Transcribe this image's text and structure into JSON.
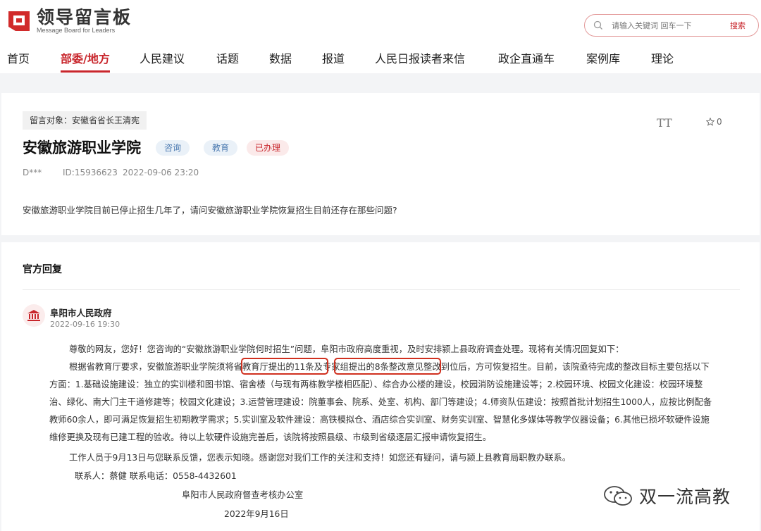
{
  "header": {
    "logo_title": "领导留言板",
    "logo_sub": "Message Board for Leaders",
    "search_placeholder": "请输入关键词 回车一下",
    "search_button": "搜索"
  },
  "nav": {
    "items": [
      "首页",
      "部委/地方",
      "人民建议",
      "话题",
      "数据",
      "报道",
      "人民日报读者来信",
      "政企直通车",
      "案例库",
      "理论"
    ],
    "active_index": 1
  },
  "message": {
    "target": "留言对象：安徽省省长王清宪",
    "title": "安徽旅游职业学院",
    "tags": [
      "咨询",
      "教育",
      "已办理"
    ],
    "author": "D***",
    "id": "ID:15936623",
    "time": "2022-09-06 23:20",
    "star_count": "0",
    "font_toggle": "TT",
    "question": "安徽旅游职业学院目前已停止招生几年了，请问安徽旅游职业学院恢复招生目前还存在那些问题?"
  },
  "reply": {
    "heading": "官方回复",
    "org": "阜阳市人民政府",
    "time": "2022-09-16 19:30",
    "lines": [
      "尊敬的网友，您好！您咨询的“安徽旅游职业学院何时招生”问题，阜阳市政府高度重视，及时安排颍上县政府调查处理。现将有关情况回复如下：",
      "根据省教育厅要求，安徽旅游职业学院须将省教育厅提出的11条及专家组提出的8条整改意见整改到位后，方可恢复招生。目前，该院亟待完成的整改目标主要包括以下",
      "方面：1.基础设施建设：独立的实训楼和图书馆、宿舍楼（与现有两栋教学楼相匹配）、综合办公楼的建设，校园消防设施建设等；2.校园环境、校园文化建设：校园环境整",
      "治、绿化、南大门主干道修建等；校园文化建设；3.运营管理建设：院董事会、院系、处室、机构、部门等建设；4.师资队伍建设：按照首批计划招生1000人，应按比例配备",
      "教师60余人，即可满足恢复招生初期教学需求；5.实训室及软件建设：高铁模拟仓、酒店综合实训室、财务实训室、智慧化多媒体等教学仪器设备；6.其他已损坏软硬件设施",
      "维修更换及现有已建工程的验收。待以上软硬件设施完善后，该院将按照县级、市级到省级逐层汇报申请恢复招生。",
      "工作人员于9月13日与您联系反馈，您表示知晓。感谢您对我们工作的关注和支持！如您还有疑问，请与颍上县教育局职教办联系。",
      "联系人：蔡健          联系电话：0558-4432601",
      "阜阳市人民政府督查考核办公室",
      "2022年9月16日"
    ]
  },
  "watermark": {
    "text": "双一流高教"
  },
  "colors": {
    "accent": "#c8262c",
    "highlight_box": "#d0301f"
  }
}
